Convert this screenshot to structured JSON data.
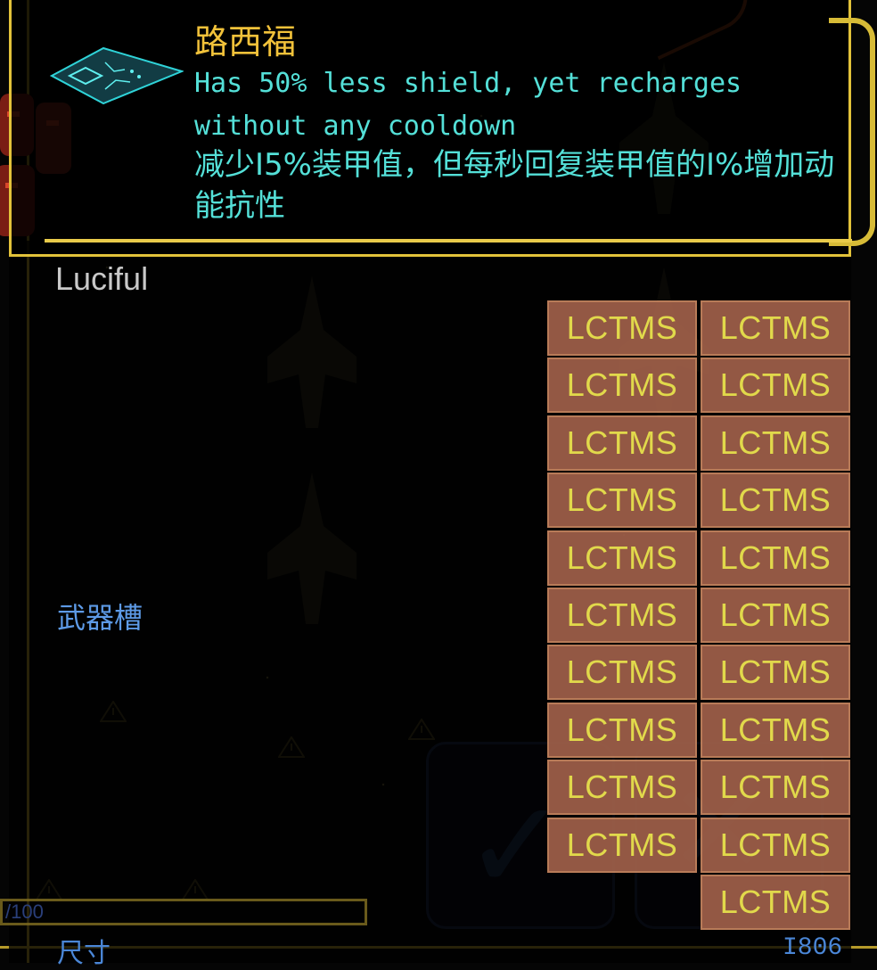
{
  "module": {
    "title": "路西福",
    "description_en": "Has 50% less shield, yet recharges without any cooldown",
    "description_cn": "减少I5%装甲值，但每秒回复装甲值的I%增加动能抗性",
    "icon": "triangle-hull-module-icon"
  },
  "ship": {
    "name": "Luciful",
    "weapon_slot_label": "武器槽"
  },
  "slots": {
    "left_column": [
      "LCTMS",
      "LCTMS",
      "LCTMS",
      "LCTMS",
      "LCTMS",
      "LCTMS",
      "LCTMS",
      "LCTMS",
      "LCTMS",
      "LCTMS"
    ],
    "right_column": [
      "LCTMS",
      "LCTMS",
      "LCTMS",
      "LCTMS",
      "LCTMS",
      "LCTMS",
      "LCTMS",
      "LCTMS",
      "LCTMS",
      "LCTMS",
      "LCTMS"
    ]
  },
  "footer": {
    "capacity_text": "/100",
    "size_label": "尺寸",
    "size_value": "I806"
  },
  "colors": {
    "title": "#f2c23a",
    "description": "#54e0d8",
    "frame": "#e2c23a",
    "slot_bg": "#a0604a",
    "slot_text": "#f4ec52",
    "label_blue": "#5d9ae6"
  }
}
